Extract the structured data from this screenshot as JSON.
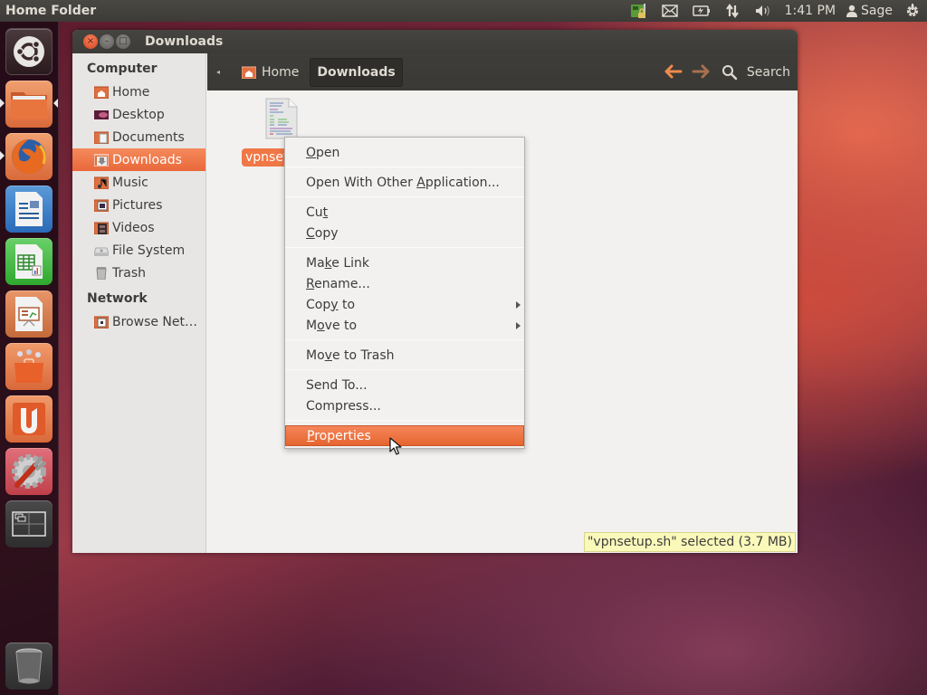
{
  "top_panel": {
    "title": "Home Folder",
    "clock": "1:41 PM",
    "user": "Sage",
    "indicators": [
      "network-lock-icon",
      "mail-icon",
      "battery-icon",
      "transfer-icon",
      "volume-icon"
    ]
  },
  "launcher": {
    "items": [
      {
        "name": "dash-home",
        "icon": "ubuntu-logo-icon"
      },
      {
        "name": "home-folder",
        "icon": "folder-icon",
        "running": true,
        "focused": true
      },
      {
        "name": "firefox",
        "icon": "firefox-icon",
        "running": true
      },
      {
        "name": "libreoffice-writer",
        "icon": "writer-icon"
      },
      {
        "name": "libreoffice-calc",
        "icon": "calc-icon"
      },
      {
        "name": "libreoffice-impress",
        "icon": "impress-icon"
      },
      {
        "name": "ubuntu-software-center",
        "icon": "software-center-icon"
      },
      {
        "name": "ubuntu-one",
        "icon": "ubuntu-one-icon"
      },
      {
        "name": "system-settings",
        "icon": "settings-icon"
      },
      {
        "name": "workspace-switcher",
        "icon": "workspaces-icon"
      },
      {
        "name": "trash",
        "icon": "trash-icon"
      }
    ]
  },
  "window": {
    "title": "Downloads",
    "buttons": {
      "close": "×",
      "minimize": "–",
      "maximize": "□"
    }
  },
  "sidebar": {
    "sections": [
      {
        "heading": "Computer",
        "items": [
          {
            "label": "Home",
            "icon": "home-folder-icon"
          },
          {
            "label": "Desktop",
            "icon": "desktop-icon"
          },
          {
            "label": "Documents",
            "icon": "documents-folder-icon"
          },
          {
            "label": "Downloads",
            "icon": "downloads-folder-icon",
            "active": true
          },
          {
            "label": "Music",
            "icon": "music-folder-icon"
          },
          {
            "label": "Pictures",
            "icon": "pictures-folder-icon"
          },
          {
            "label": "Videos",
            "icon": "videos-folder-icon"
          },
          {
            "label": "File System",
            "icon": "drive-icon"
          },
          {
            "label": "Trash",
            "icon": "trash-icon"
          }
        ]
      },
      {
        "heading": "Network",
        "items": [
          {
            "label": "Browse Net…",
            "icon": "network-folder-icon"
          }
        ]
      }
    ]
  },
  "toolbar": {
    "breadcrumbs": [
      {
        "label": "Home"
      },
      {
        "label": "Downloads",
        "current": true
      }
    ],
    "back_color": "#f08a4b",
    "forward_color": "#a8704f",
    "search_label": "Search"
  },
  "files": [
    {
      "name": "vpnsetup.sh",
      "visible_label": "vpnset",
      "selected": true
    }
  ],
  "context_menu": {
    "groups": [
      [
        {
          "label": "Open",
          "mnemonic": "O"
        }
      ],
      [
        {
          "label": "Open With Other Application...",
          "mnemonic": "A"
        }
      ],
      [
        {
          "label": "Cut",
          "mnemonic": "t"
        },
        {
          "label": "Copy",
          "mnemonic": "C"
        }
      ],
      [
        {
          "label": "Make Link",
          "mnemonic": "k"
        },
        {
          "label": "Rename...",
          "mnemonic": "R"
        },
        {
          "label": "Copy to",
          "mnemonic": "y",
          "submenu": true
        },
        {
          "label": "Move to",
          "mnemonic": "o",
          "submenu": true
        }
      ],
      [
        {
          "label": "Move to Trash",
          "mnemonic": "v"
        }
      ],
      [
        {
          "label": "Send To..."
        },
        {
          "label": "Compress..."
        }
      ],
      [
        {
          "label": "Properties",
          "mnemonic": "P",
          "highlighted": true
        }
      ]
    ]
  },
  "status_bar": {
    "text": "\"vpnsetup.sh\" selected (3.7 MB)"
  },
  "colors": {
    "accent": "#f07746",
    "panel": "#3c3b37",
    "sidebar_bg": "#e7e6e4",
    "content_bg": "#f2f1f0",
    "status_bg": "#fbf9ba"
  }
}
